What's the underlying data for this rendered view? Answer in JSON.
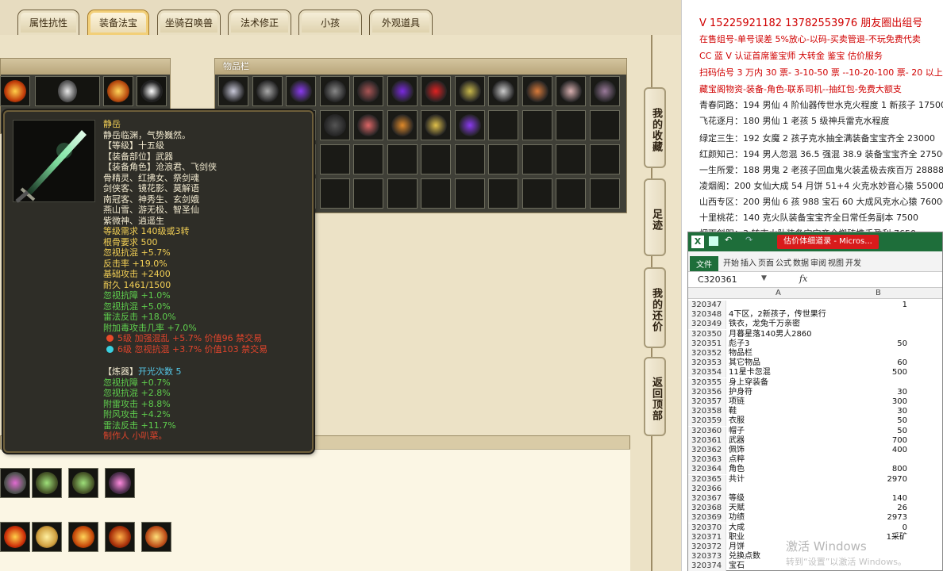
{
  "tabs": [
    "属性抗性",
    "装备法宝",
    "坐骑召唤兽",
    "法术修正",
    "小孩",
    "外观道具"
  ],
  "active_tab_index": 1,
  "inventory_title": "物品栏",
  "tooltip": {
    "name": "静岳",
    "desc": "静岳临渊，气势巍然。",
    "level": "【等级】十五级",
    "slot": "【装备部位】武器",
    "roles_label": "【装备角色】沧浪君、飞剑侠",
    "roles": [
      "骨精灵、红拂女、祭剑魂",
      "剑侠客、镜花影、莫解语",
      "南冠客、神秀生、玄剑娥",
      "燕山雪、游无极、智圣仙",
      "紫微神、逍遥生"
    ],
    "req_level": "等级需求 140级或3转",
    "req_bone": "根骨要求 500",
    "stats_yellow": [
      "忽视抗混 +5.7%",
      "反击率 +19.0%",
      "基础攻击 +2400",
      "耐久 1461/1500"
    ],
    "stats_green": [
      "忽视抗障 +1.0%",
      "忽视抗混 +5.0%",
      "雷法反击 +18.0%",
      "附加毒攻击几率 +7.0%"
    ],
    "gems": [
      "5级 加强混乱 +5.7% 价值96 禁交易",
      "6级 忽视抗混 +3.7% 价值103 禁交易"
    ],
    "refine_label": "【炼器】",
    "refine_count": "开光次数 5",
    "refine_stats": [
      "忽视抗障 +0.7%",
      "忽视抗混 +2.8%",
      "附雷攻击 +8.8%",
      "附风攻击 +4.2%",
      "雷法反击 +11.7%"
    ],
    "maker": "制作人 小叭菜。"
  },
  "side_buttons": [
    "我的收藏",
    "足迹",
    "我的还价",
    "返回顶部"
  ],
  "notes": [
    {
      "text": "V 15225921182  13782553976 朋友圈出组号",
      "color": "#d00000"
    },
    {
      "text": "在售组号-单号误差 5%放心-以码-买卖管退-不玩免费代卖",
      "color": "#d00000"
    },
    {
      "text": "CC 蓝 V 认证首席鉴宝师 大转金 鉴宝 估价服务",
      "color": "#d00000"
    },
    {
      "text": "扫码估号 3 万内 30 票- 3-10-50 票 --10-20-100 票- 20 以上 150",
      "color": "#d00000"
    },
    {
      "text": "藏宝阁物资-装备-角色-联系司机--抽红包-免费大额支",
      "color": "#d00000"
    },
    {
      "text": "青春同路：194 男仙 4 阶仙器传世水克火程度 1 新孩子 17500",
      "color": "#222"
    },
    {
      "text": "飞花逐月：180 男仙 1 老孩 5 级神兵雷克水程度",
      "color": "#222"
    },
    {
      "text": "绿定三生：192 女魔 2 孩子克水抽全满装备宝宝齐全 23000",
      "color": "#222"
    },
    {
      "text": "红颜知己：194 男人忽混 36.5 强混 38.9 装备宝宝齐全 27500",
      "color": "#222"
    },
    {
      "text": "一生所爱：188 男鬼 2 老孩子回血鬼火装孟极去疾百万 28888",
      "color": "#222"
    },
    {
      "text": "凌烟阁：200 女仙大成 54 月饼 51+4 火克水妙音心猿 55000",
      "color": "#222"
    },
    {
      "text": "山西专区：200 男仙 6 孩 988 宝石 60 大成风克水心猿 76000",
      "color": "#222"
    },
    {
      "text": "十里桃花：140 克火队装备宝宝齐全日常任务副本 7500",
      "color": "#222"
    },
    {
      "text": "烟雨斜阳：3 转克火队装备宝宝齐全搬砖携手盈利 7650",
      "color": "#222"
    }
  ],
  "excel": {
    "title": "估价体细道录 - Micros...",
    "ribbon": [
      "文件",
      "开始",
      "插入",
      "页面",
      "公式",
      "数据",
      "审阅",
      "视图",
      "开发"
    ],
    "name_box": "C320361",
    "fx": "fx",
    "col_a": "A",
    "col_b": "B",
    "rows": [
      {
        "n": "320347",
        "a": "",
        "b": "1"
      },
      {
        "n": "320348",
        "a": "4下区，2新孩子，传世果行铁衣，龙兔千万亲密",
        "b": ""
      },
      {
        "n": "320349",
        "a": "",
        "b": ""
      },
      {
        "n": "320350",
        "a": "月暮星落140男人2860",
        "b": ""
      },
      {
        "n": "320351",
        "a": "彪子3",
        "b": "50"
      },
      {
        "n": "320352",
        "a": "物品栏",
        "b": ""
      },
      {
        "n": "320353",
        "a": "其它物品",
        "b": "60"
      },
      {
        "n": "320354",
        "a": "11星卡忽混",
        "b": "500"
      },
      {
        "n": "320355",
        "a": "身上穿装备",
        "b": ""
      },
      {
        "n": "320356",
        "a": "护身符",
        "b": "30"
      },
      {
        "n": "320357",
        "a": "项链",
        "b": "300"
      },
      {
        "n": "320358",
        "a": "鞋",
        "b": "30"
      },
      {
        "n": "320359",
        "a": "衣服",
        "b": "50"
      },
      {
        "n": "320360",
        "a": "帽子",
        "b": "50"
      },
      {
        "n": "320361",
        "a": "武器",
        "b": "700"
      },
      {
        "n": "320362",
        "a": "佩饰",
        "b": "400"
      },
      {
        "n": "320363",
        "a": "点粹",
        "b": ""
      },
      {
        "n": "320364",
        "a": "角色",
        "b": "800"
      },
      {
        "n": "320365",
        "a": "共计",
        "b": "2970"
      },
      {
        "n": "320366",
        "a": "",
        "b": ""
      },
      {
        "n": "320367",
        "a": "等级",
        "b": "140"
      },
      {
        "n": "320368",
        "a": "天赋",
        "b": "26"
      },
      {
        "n": "320369",
        "a": "功绩",
        "b": "2973"
      },
      {
        "n": "320370",
        "a": "大成",
        "b": "0"
      },
      {
        "n": "320371",
        "a": "职业",
        "b": "1采矿"
      },
      {
        "n": "320372",
        "a": "月饼",
        "b": ""
      },
      {
        "n": "320373",
        "a": "兑换点数",
        "b": ""
      },
      {
        "n": "320374",
        "a": "宝石",
        "b": ""
      }
    ]
  },
  "watermark": "激活 Windows",
  "watermark_sub": "转到“设置”以激活 Windows。"
}
